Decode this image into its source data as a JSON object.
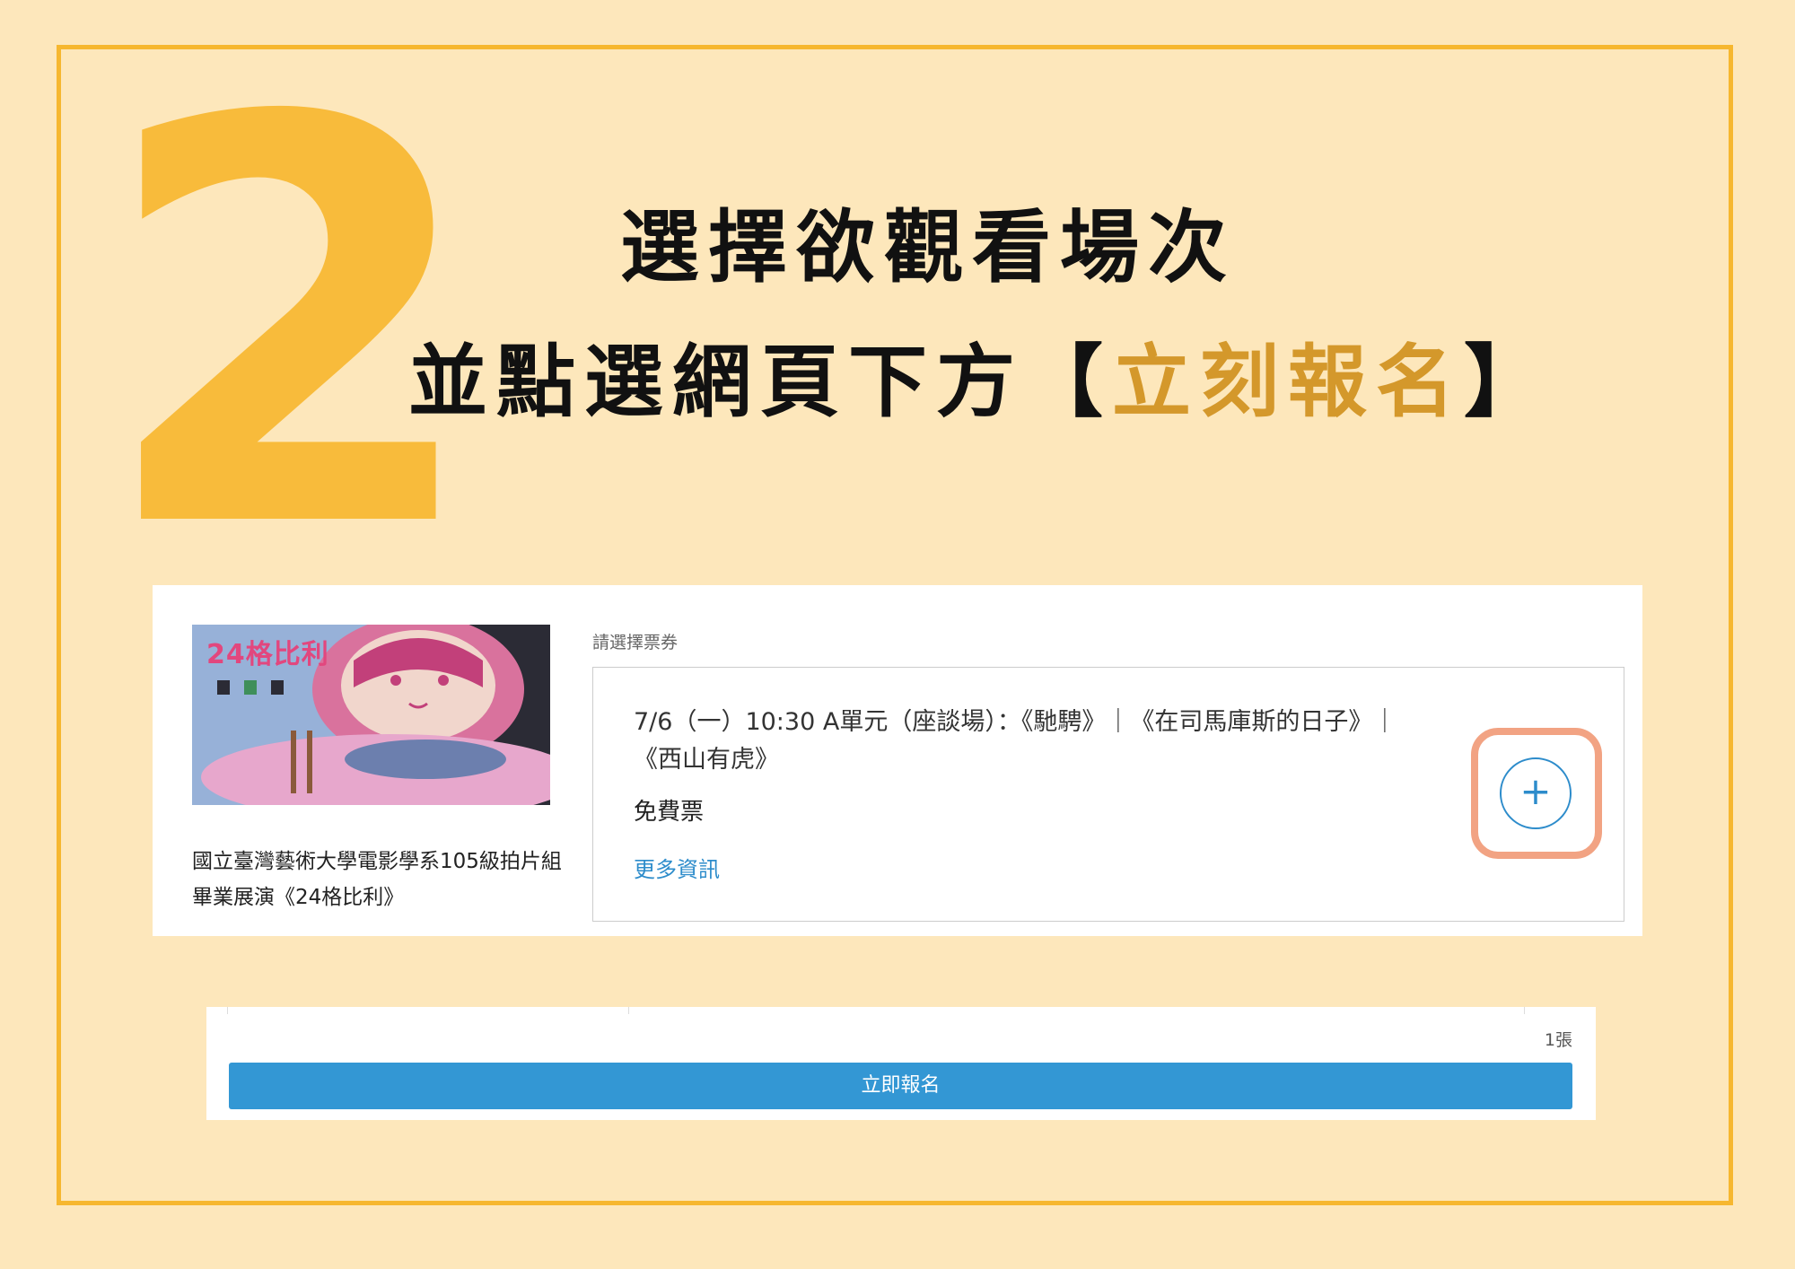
{
  "heading": {
    "step_number": "2",
    "line1": "選擇欲觀看場次",
    "line2_prefix": "並點選網頁下方",
    "line2_bracket_open": "【",
    "line2_highlight": "立刻報名",
    "line2_bracket_close": "】"
  },
  "event": {
    "poster_title": "24格比利",
    "title": "國立臺灣藝術大學電影學系105級拍片組畢業展演《24格比利》"
  },
  "ticket_section": {
    "label": "請選擇票券",
    "ticket_name": "7/6（一）10:30 A單元（座談場）：《馳騁》｜《在司馬庫斯的日子》｜《西山有虎》",
    "ticket_type": "免費票",
    "more_info": "更多資訊",
    "add_symbol": "+"
  },
  "footer": {
    "count": "1張",
    "register_label": "立即報名"
  },
  "colors": {
    "background": "#fde7bb",
    "frame": "#f6b72f",
    "step_number": "#f8bb3b",
    "highlight_text": "#d4982b",
    "link_blue": "#2d8ccb",
    "button_blue": "#3397d4",
    "focus_ring": "#f2a383"
  }
}
